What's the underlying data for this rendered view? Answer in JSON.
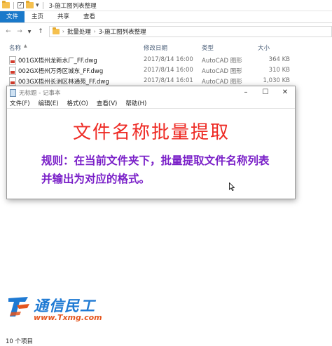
{
  "explorer": {
    "title": "3-施工图列表整理",
    "ribbon_tabs": [
      "文件",
      "主页",
      "共享",
      "查看"
    ],
    "breadcrumb": [
      "批量处理",
      "3-施工图列表整理"
    ],
    "columns": {
      "name": "名称",
      "modified": "修改日期",
      "type": "类型",
      "size": "大小"
    },
    "files": [
      {
        "name": "001GX梧州龙新水厂_FF.dwg",
        "modified": "2017/8/14 16:00",
        "type": "AutoCAD 图形",
        "size": "364 KB"
      },
      {
        "name": "002GX梧州万秀区城东_FF.dwg",
        "modified": "2017/8/14 16:00",
        "type": "AutoCAD 图形",
        "size": "310 KB"
      },
      {
        "name": "003GX梧州长洲区林通苑_FF.dwg",
        "modified": "2017/8/14 16:01",
        "type": "AutoCAD 图形",
        "size": "1,030 KB"
      }
    ],
    "status": "10 个项目"
  },
  "notepad": {
    "title": "无标题 - 记事本",
    "menu": [
      "文件(F)",
      "编辑(E)",
      "格式(O)",
      "查看(V)",
      "帮助(H)"
    ],
    "heading": "文件名称批量提取",
    "body": "规则：在当前文件夹下，批量提取文件名称列表并输出为对应的格式。",
    "heading_color": "#ee2a24",
    "body_color": "#7a20c8"
  },
  "watermark": {
    "name": "通信民工",
    "url": "www.Txmg.com"
  },
  "colors": {
    "accent": "#1979ca"
  }
}
